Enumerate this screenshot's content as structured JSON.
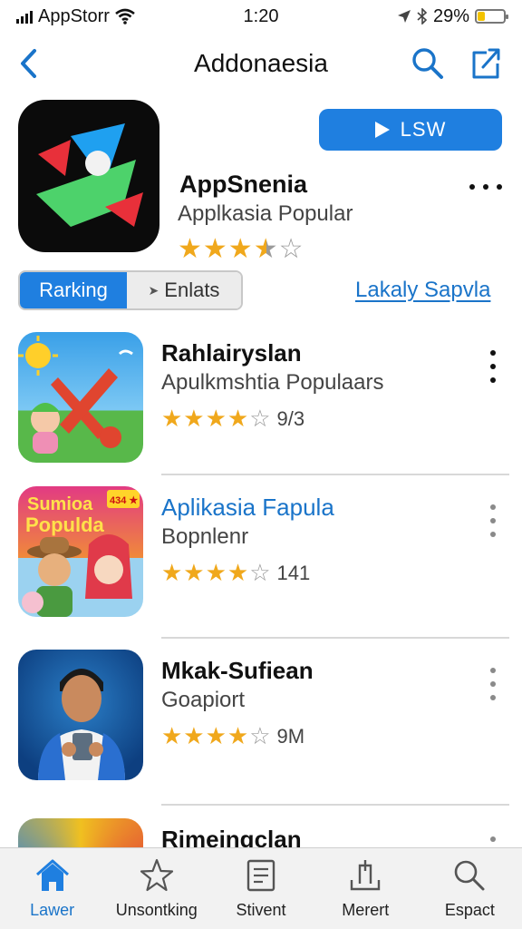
{
  "status_bar": {
    "carrier": "AppStorr",
    "time": "1:20",
    "battery": "29%",
    "battery_level": 0.29
  },
  "nav": {
    "title": "Addonaesia",
    "back_icon": "chevron-left-icon",
    "search_icon": "search-icon",
    "share_icon": "share-icon"
  },
  "featured": {
    "name": "AppSnenia",
    "subtitle": "Applkasia Popular",
    "get_label": "LSW",
    "rating": 3.5,
    "stars_filled": "★★★",
    "star_half": "★",
    "stars_empty": "☆"
  },
  "segment": {
    "tab_a": "Rarking",
    "tab_b": "Enlats",
    "tab_b_arrow": "➤",
    "see_all": "Lakaly Sapvla"
  },
  "apps": [
    {
      "title": "Rahlairyslan",
      "subtitle": "Apulkmshtia Populaars",
      "stars_filled": "★★★★",
      "stars_empty": "☆",
      "rating_count": "9/3"
    },
    {
      "title": "Aplikasia Fapula",
      "subtitle": "Bopnlenr",
      "stars_filled": "★★★★",
      "stars_empty": "☆",
      "rating_count": "141",
      "icon_text_top": "Sumioa",
      "icon_text_bottom": "Populda",
      "icon_badge": "434 ★"
    },
    {
      "title": "Mkak-Sufiean",
      "subtitle": "Goapiort",
      "stars_filled": "★★★★",
      "stars_empty": "☆",
      "rating_count": "9M"
    },
    {
      "title": "Rimeingclan"
    }
  ],
  "tab_bar": [
    {
      "label": "Lawer",
      "icon": "home-icon",
      "active": true
    },
    {
      "label": "Unsontking",
      "icon": "star-icon",
      "active": false
    },
    {
      "label": "Stivent",
      "icon": "document-icon",
      "active": false
    },
    {
      "label": "Merert",
      "icon": "upload-tray-icon",
      "active": false
    },
    {
      "label": "Espact",
      "icon": "search-icon",
      "active": false
    }
  ],
  "colors": {
    "accent": "#1f7fe0",
    "link": "#1a74c9",
    "star": "#f0a81c"
  }
}
